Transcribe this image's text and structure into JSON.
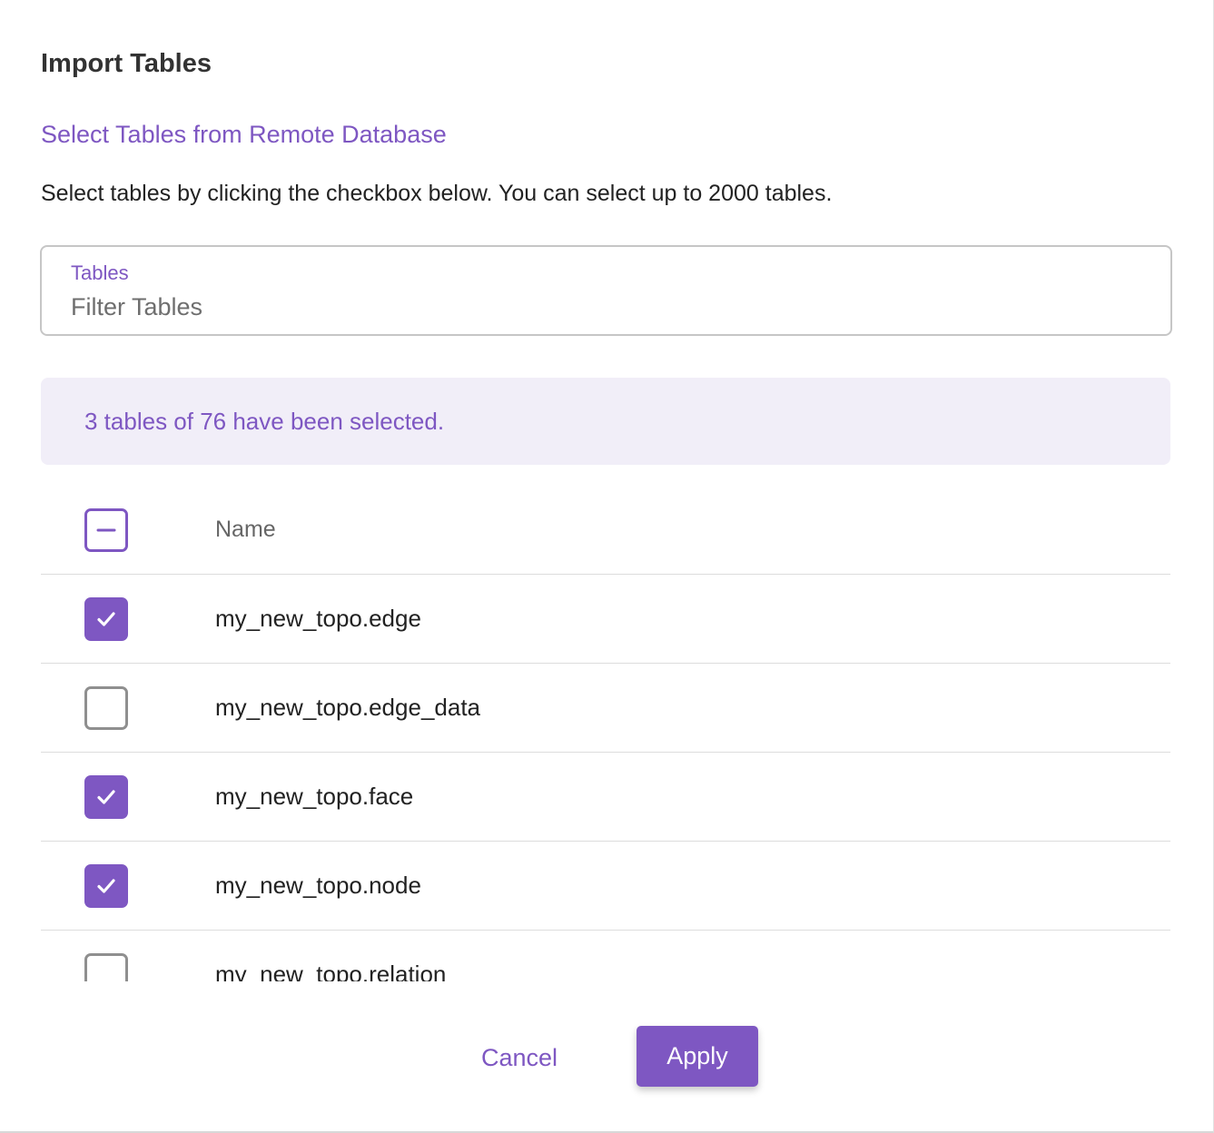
{
  "dialog": {
    "title": "Import Tables",
    "subtitle": "Select Tables from Remote Database",
    "description": "Select tables by clicking the checkbox below. You can select up to 2000 tables."
  },
  "filter": {
    "label": "Tables",
    "placeholder": "Filter Tables",
    "value": ""
  },
  "selection": {
    "message": "3 tables of 76 have been selected.",
    "selected_count": 3,
    "total_count": 76
  },
  "table": {
    "header": {
      "name_label": "Name",
      "select_all_state": "indeterminate"
    },
    "rows": [
      {
        "name": "my_new_topo.edge",
        "checked": true
      },
      {
        "name": "my_new_topo.edge_data",
        "checked": false
      },
      {
        "name": "my_new_topo.face",
        "checked": true
      },
      {
        "name": "my_new_topo.node",
        "checked": true
      },
      {
        "name": "my_new_topo.relation",
        "checked": false
      }
    ]
  },
  "footer": {
    "cancel_label": "Cancel",
    "apply_label": "Apply"
  },
  "colors": {
    "accent": "#7e57c2",
    "banner_bg": "#f1eef8",
    "text": "#222222"
  },
  "icons": {
    "checked": "check-icon",
    "indeterminate": "minus-icon"
  }
}
